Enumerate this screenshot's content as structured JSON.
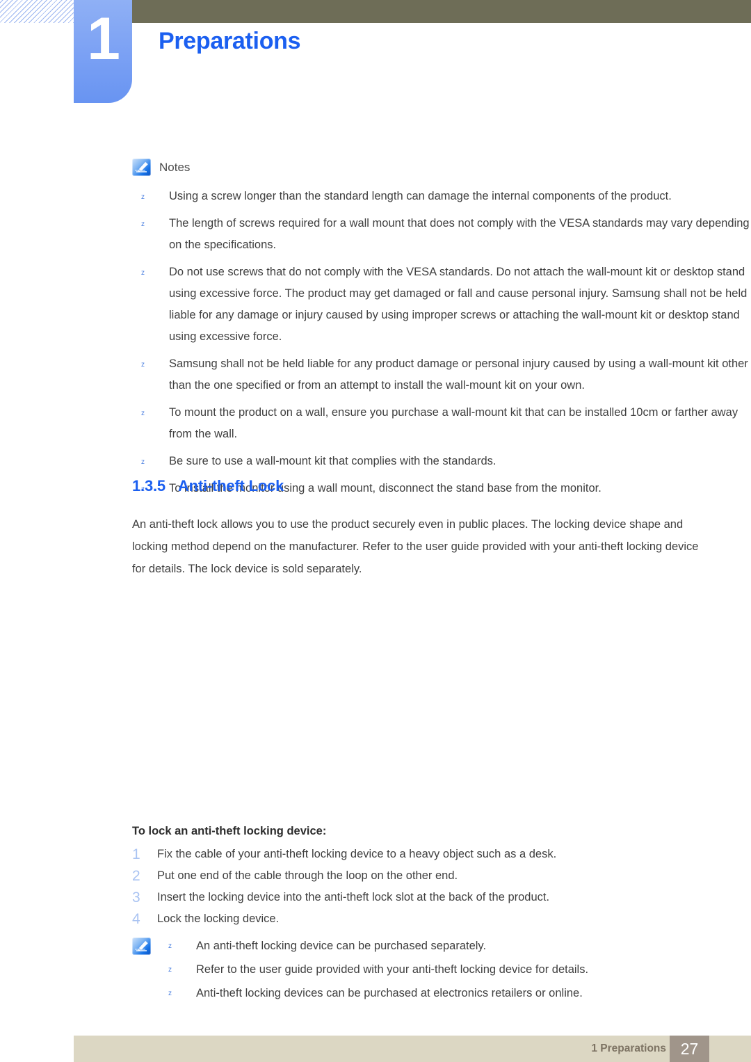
{
  "header": {
    "chapter_number": "1",
    "chapter_title": "Preparations",
    "accent_blue": "#1b5ff0",
    "tab_blue": "#7ea3f4",
    "olive": "#6e6d57"
  },
  "notes_top": {
    "icon_name": "note-pencil-icon",
    "label": "Notes",
    "bullet_glyph": "z",
    "items": [
      "Using a screw longer than the standard length can damage the internal components of the product.",
      "The length of screws required for a wall mount that does not comply with the VESA standards may vary depending on the specifications.",
      "Do not use screws that do not comply with the VESA standards. Do not attach the wall-mount kit or desktop stand using excessive force. The product may get damaged or fall and cause personal injury. Samsung shall not be held liable for any damage or injury caused by using improper screws or attaching the wall-mount kit or desktop stand using excessive force.",
      "Samsung shall not be held liable for any product damage or personal injury caused by using a wall-mount kit other than the one specified or from an attempt to install the wall-mount kit on your own.",
      "To mount the product on a wall, ensure you purchase a wall-mount kit that can be installed 10cm or farther away from the wall.",
      "Be sure to use a wall-mount kit that complies with the standards.",
      "To install the monitor using a wall mount, disconnect the stand base from the monitor."
    ]
  },
  "section": {
    "number": "1.3.5",
    "title": "Anti-theft Lock",
    "paragraph": "An anti-theft lock allows you to use the product securely even in public places. The locking device shape and locking method depend on the manufacturer. Refer to the user guide provided with your anti-theft locking device for details. The lock device is sold separately."
  },
  "procedure": {
    "title": "To lock an anti-theft locking device:",
    "steps": [
      {
        "number": "1",
        "text": "Fix the cable of your anti-theft locking device to a heavy object such as a desk."
      },
      {
        "number": "2",
        "text": "Put one end of the cable through the loop on the other end."
      },
      {
        "number": "3",
        "text": "Insert the locking device into the anti-theft lock slot at the back of the product."
      },
      {
        "number": "4",
        "text": "Lock the locking device."
      }
    ]
  },
  "notes_bottom": {
    "icon_name": "note-pencil-icon",
    "bullet_glyph": "z",
    "items": [
      "An anti-theft locking device can be purchased separately.",
      "Refer to the user guide provided with your anti-theft locking device for details.",
      "Anti-theft locking devices can be purchased at electronics retailers or online."
    ]
  },
  "footer": {
    "label": "1 Preparations",
    "page_number": "27",
    "bar_color": "#dcd7c3",
    "page_box_color": "#a0958a"
  }
}
